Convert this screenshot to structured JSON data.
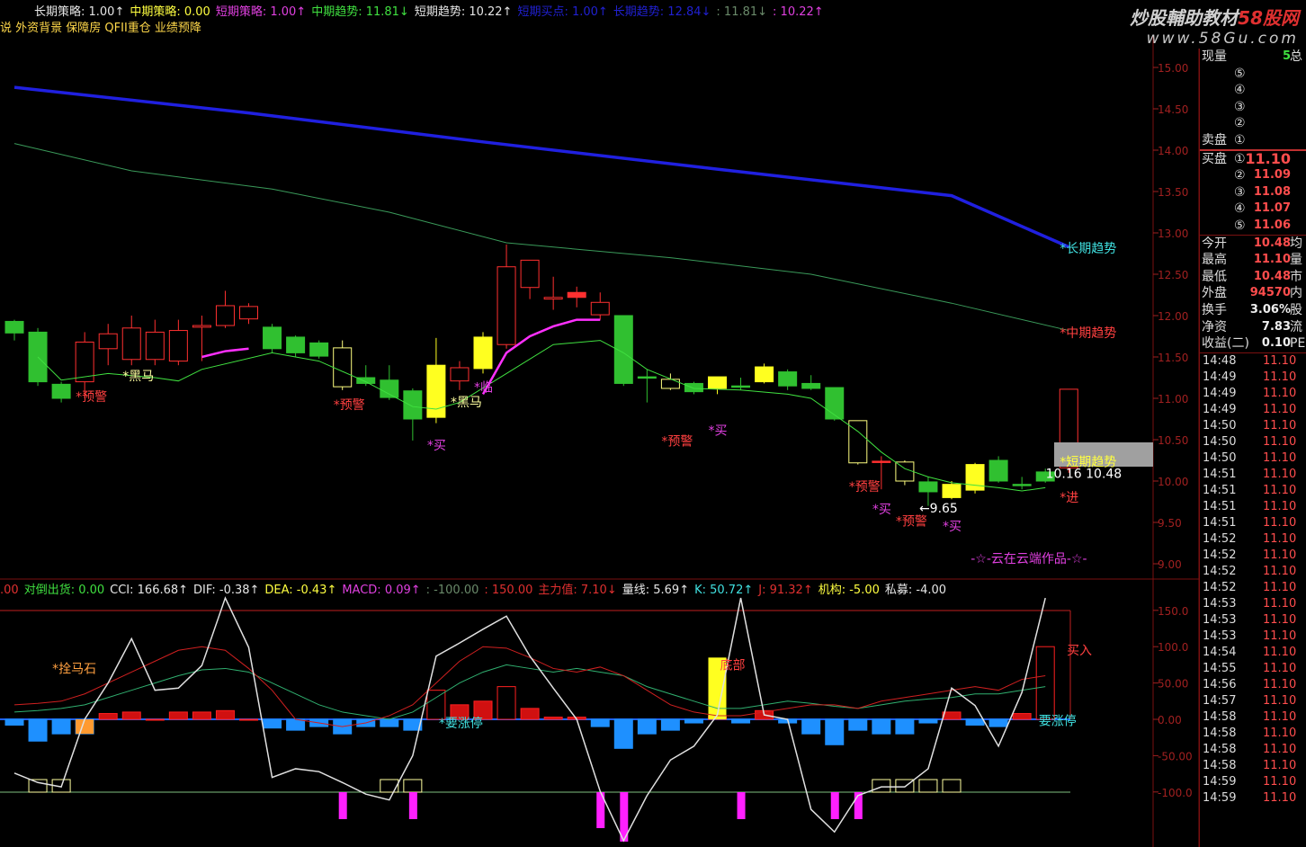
{
  "header": {
    "items": [
      {
        "label": "长期策略: 1.00↑",
        "color": "#e6e6e6"
      },
      {
        "label": "中期策略: 0.00",
        "color": "#ffff40"
      },
      {
        "label": "短期策略: 1.00↑",
        "color": "#e040e0"
      },
      {
        "label": "中期趋势: 11.81↓",
        "color": "#40e040"
      },
      {
        "label": "短期趋势: 10.22↑",
        "color": "#e6e6e6"
      },
      {
        "label": "短期买点: 1.00↑",
        "color": "#2020d0"
      },
      {
        "label": "长期趋势: 12.84↓",
        "color": "#2020d0"
      },
      {
        "label": ": 11.81↓",
        "color": "#6a8a6a"
      },
      {
        "label": ": 10.22↑",
        "color": "#e040e0"
      }
    ],
    "tags": "说 外资背景 保障房 QFII重仓 业绩预降"
  },
  "indicator_header": {
    "items": [
      {
        "label": ".00",
        "color": "#e03030"
      },
      {
        "label": "对倒出货: 0.00",
        "color": "#40e040"
      },
      {
        "label": "CCI: 166.68↑",
        "color": "#e6e6e6"
      },
      {
        "label": "DIF: -0.38↑",
        "color": "#e6e6e6"
      },
      {
        "label": "DEA: -0.43↑",
        "color": "#ffff40"
      },
      {
        "label": "MACD: 0.09↑",
        "color": "#e040e0"
      },
      {
        "label": ": -100.00",
        "color": "#6a8a6a"
      },
      {
        "label": ": 150.00",
        "color": "#e03030"
      },
      {
        "label": "主力值: 7.10↓",
        "color": "#e03030"
      },
      {
        "label": "量线: 5.69↑",
        "color": "#e6e6e6"
      },
      {
        "label": "K: 50.72↑",
        "color": "#40e0e0"
      },
      {
        "label": "J: 91.32↑",
        "color": "#e03030"
      },
      {
        "label": "机构: -5.00",
        "color": "#ffff40"
      },
      {
        "label": "私募: -4.00",
        "color": "#e6e6e6"
      }
    ]
  },
  "watermark": {
    "line1a": "炒股輔助教材",
    "line1b": "58股网",
    "line2": "www.58Gu.com"
  },
  "quote_panel": {
    "volume_label": "现量",
    "volume_value": "5",
    "total_label": "总",
    "sell_label": "卖盘",
    "buy_label": "买盘",
    "sell_levels": [
      "⑤",
      "④",
      "③",
      "②",
      "①"
    ],
    "buy_levels": [
      {
        "n": "①",
        "p": "11.10"
      },
      {
        "n": "②",
        "p": "11.09"
      },
      {
        "n": "③",
        "p": "11.08"
      },
      {
        "n": "④",
        "p": "11.07"
      },
      {
        "n": "⑤",
        "p": "11.06"
      }
    ],
    "stats": [
      {
        "l": "今开",
        "v": "10.48",
        "r": "均"
      },
      {
        "l": "最高",
        "v": "11.10",
        "r": "量"
      },
      {
        "l": "最低",
        "v": "10.48",
        "r": "市"
      },
      {
        "l": "外盘",
        "v": "94570",
        "r": "内"
      },
      {
        "l": "换手",
        "v": "3.06%",
        "r": "股"
      },
      {
        "l": "净资",
        "v": "7.83",
        "r": "流"
      },
      {
        "l": "收益(二)",
        "v": "0.10",
        "r": "PE"
      }
    ],
    "ticks": [
      {
        "t": "14:48",
        "p": "11.10"
      },
      {
        "t": "14:49",
        "p": "11.10"
      },
      {
        "t": "14:49",
        "p": "11.10"
      },
      {
        "t": "14:49",
        "p": "11.10"
      },
      {
        "t": "14:50",
        "p": "11.10"
      },
      {
        "t": "14:50",
        "p": "11.10"
      },
      {
        "t": "14:50",
        "p": "11.10"
      },
      {
        "t": "14:51",
        "p": "11.10"
      },
      {
        "t": "14:51",
        "p": "11.10"
      },
      {
        "t": "14:51",
        "p": "11.10"
      },
      {
        "t": "14:51",
        "p": "11.10"
      },
      {
        "t": "14:52",
        "p": "11.10"
      },
      {
        "t": "14:52",
        "p": "11.10"
      },
      {
        "t": "14:52",
        "p": "11.10"
      },
      {
        "t": "14:52",
        "p": "11.10"
      },
      {
        "t": "14:53",
        "p": "11.10"
      },
      {
        "t": "14:53",
        "p": "11.10"
      },
      {
        "t": "14:53",
        "p": "11.10"
      },
      {
        "t": "14:54",
        "p": "11.10"
      },
      {
        "t": "14:55",
        "p": "11.10"
      },
      {
        "t": "14:56",
        "p": "11.10"
      },
      {
        "t": "14:57",
        "p": "11.10"
      },
      {
        "t": "14:58",
        "p": "11.10"
      },
      {
        "t": "14:58",
        "p": "11.10"
      },
      {
        "t": "14:58",
        "p": "11.10"
      },
      {
        "t": "14:58",
        "p": "11.10"
      },
      {
        "t": "14:59",
        "p": "11.10"
      },
      {
        "t": "14:59",
        "p": "11.10"
      }
    ]
  },
  "chart_data": [
    {
      "type": "candlestick",
      "title": "price",
      "ylim": [
        9.0,
        15.0
      ],
      "yticks": [
        "15.00",
        "14.50",
        "14.00",
        "13.50",
        "13.00",
        "12.50",
        "12.00",
        "11.50",
        "11.00",
        "10.50",
        "10.00",
        "9.50",
        "9.00"
      ],
      "candles": [
        [
          11.93,
          11.79,
          11.95,
          11.7,
          "g"
        ],
        [
          11.8,
          11.2,
          11.85,
          11.15,
          "g"
        ],
        [
          11.17,
          11.0,
          11.2,
          10.95,
          "g"
        ],
        [
          11.2,
          11.68,
          11.8,
          11.0,
          "r"
        ],
        [
          11.6,
          11.78,
          11.9,
          11.4,
          "r"
        ],
        [
          11.47,
          11.85,
          12.0,
          11.4,
          "r"
        ],
        [
          11.47,
          11.8,
          11.95,
          11.4,
          "r"
        ],
        [
          11.45,
          11.82,
          11.95,
          11.4,
          "r"
        ],
        [
          11.86,
          11.88,
          12.0,
          11.45,
          "r"
        ],
        [
          11.88,
          12.12,
          12.3,
          11.85,
          "r"
        ],
        [
          11.96,
          12.11,
          12.15,
          11.9,
          "r"
        ],
        [
          11.86,
          11.6,
          11.9,
          11.55,
          "g"
        ],
        [
          11.74,
          11.55,
          11.76,
          11.5,
          "g"
        ],
        [
          11.67,
          11.51,
          11.7,
          11.48,
          "g"
        ],
        [
          11.14,
          11.61,
          11.7,
          11.1,
          "yh"
        ],
        [
          11.25,
          11.18,
          11.4,
          11.15,
          "g"
        ],
        [
          11.22,
          11.01,
          11.4,
          10.98,
          "g"
        ],
        [
          11.09,
          10.75,
          11.12,
          10.49,
          "g"
        ],
        [
          10.77,
          11.4,
          11.73,
          10.7,
          "y"
        ],
        [
          11.21,
          11.37,
          11.45,
          11.1,
          "r"
        ],
        [
          11.36,
          11.74,
          11.8,
          11.3,
          "y"
        ],
        [
          11.65,
          12.59,
          12.86,
          11.6,
          "r"
        ],
        [
          12.34,
          12.67,
          12.67,
          12.2,
          "r"
        ],
        [
          12.2,
          12.22,
          12.47,
          12.07,
          "r"
        ],
        [
          12.28,
          12.22,
          12.35,
          12.1,
          "r"
        ],
        [
          12.01,
          12.16,
          12.28,
          11.95,
          "r"
        ],
        [
          12.0,
          11.18,
          12.0,
          11.15,
          "g"
        ],
        [
          11.26,
          11.26,
          11.35,
          10.95,
          "g"
        ],
        [
          11.12,
          11.23,
          11.3,
          11.1,
          "yh"
        ],
        [
          11.18,
          11.08,
          11.2,
          11.05,
          "g"
        ],
        [
          11.12,
          11.26,
          11.26,
          11.05,
          "y"
        ],
        [
          11.15,
          11.15,
          11.25,
          11.1,
          "g"
        ],
        [
          11.2,
          11.38,
          11.42,
          11.18,
          "y"
        ],
        [
          11.32,
          11.15,
          11.35,
          11.1,
          "g"
        ],
        [
          11.18,
          11.12,
          11.28,
          11.1,
          "g"
        ],
        [
          11.13,
          10.75,
          11.13,
          10.73,
          "g"
        ],
        [
          10.22,
          10.73,
          10.73,
          10.2,
          "yh"
        ],
        [
          10.24,
          10.24,
          10.3,
          9.9,
          "r"
        ],
        [
          10.0,
          10.23,
          10.25,
          9.95,
          "yh"
        ],
        [
          9.99,
          9.87,
          10.05,
          9.7,
          "g"
        ],
        [
          9.8,
          9.96,
          10.0,
          9.78,
          "y"
        ],
        [
          9.89,
          10.2,
          10.22,
          9.85,
          "y"
        ],
        [
          10.25,
          10.0,
          10.3,
          9.98,
          "g"
        ],
        [
          9.96,
          9.95,
          10.05,
          9.9,
          "g"
        ],
        [
          10.11,
          10.0,
          10.15,
          9.98,
          "g"
        ],
        [
          10.16,
          11.11,
          11.11,
          10.1,
          "rh"
        ]
      ],
      "long_trend": [
        [
          0,
          14.76
        ],
        [
          10,
          14.45
        ],
        [
          20,
          14.1
        ],
        [
          30,
          13.77
        ],
        [
          40,
          13.45
        ],
        [
          45,
          12.83
        ]
      ],
      "mid_trend": [
        [
          0,
          14.08
        ],
        [
          5,
          13.75
        ],
        [
          11,
          13.53
        ],
        [
          16,
          13.25
        ],
        [
          21,
          12.88
        ],
        [
          28,
          12.7
        ],
        [
          34,
          12.5
        ],
        [
          40,
          12.15
        ],
        [
          45,
          11.82
        ]
      ],
      "short_trend": [
        [
          1,
          11.5
        ],
        [
          2,
          11.22
        ],
        [
          4,
          11.3
        ],
        [
          6,
          11.25
        ],
        [
          7,
          11.21
        ],
        [
          8,
          11.35
        ],
        [
          11,
          11.55
        ],
        [
          13,
          11.45
        ],
        [
          15,
          11.2
        ],
        [
          17,
          10.9
        ],
        [
          18,
          10.87
        ],
        [
          19,
          10.95
        ],
        [
          21,
          11.3
        ],
        [
          23,
          11.65
        ],
        [
          25,
          11.7
        ],
        [
          26,
          11.55
        ],
        [
          27,
          11.35
        ],
        [
          29,
          11.12
        ],
        [
          31,
          11.1
        ],
        [
          33,
          11.05
        ],
        [
          34,
          11.0
        ],
        [
          35,
          10.8
        ],
        [
          36,
          10.6
        ],
        [
          37,
          10.35
        ],
        [
          38,
          10.15
        ],
        [
          39,
          10.05
        ],
        [
          40,
          9.98
        ],
        [
          42,
          9.92
        ],
        [
          43,
          9.88
        ],
        [
          44,
          9.92
        ]
      ],
      "magenta_segments": [
        [
          [
            8,
            11.5
          ],
          [
            9,
            11.57
          ],
          [
            10,
            11.6
          ]
        ],
        [
          [
            20,
            11.05
          ],
          [
            21,
            11.55
          ],
          [
            22,
            11.75
          ],
          [
            23,
            11.87
          ],
          [
            24,
            11.95
          ],
          [
            25,
            11.95
          ]
        ]
      ],
      "annotations": [
        {
          "text": "*黑马",
          "i": 5,
          "p": 11.22,
          "c": "#ffffa0"
        },
        {
          "text": "*预警",
          "i": 3,
          "p": 10.97,
          "c": "#ff4040"
        },
        {
          "text": "*预警",
          "i": 14,
          "p": 10.87,
          "c": "#ff4040"
        },
        {
          "text": "*黑马",
          "i": 19,
          "p": 10.9,
          "c": "#ffffa0"
        },
        {
          "text": "*买",
          "i": 18,
          "p": 10.38,
          "c": "#e040e0"
        },
        {
          "text": "*临",
          "i": 20,
          "p": 11.08,
          "c": "#e040e0"
        },
        {
          "text": "*预警",
          "i": 28,
          "p": 10.43,
          "c": "#ff4040"
        },
        {
          "text": "*买",
          "i": 30,
          "p": 10.56,
          "c": "#e040e0"
        },
        {
          "text": "*预警",
          "i": 36,
          "p": 9.88,
          "c": "#ff4040"
        },
        {
          "text": "*买",
          "i": 37,
          "p": 9.61,
          "c": "#e040e0"
        },
        {
          "text": "*预警",
          "i": 38,
          "p": 9.46,
          "c": "#ff4040"
        },
        {
          "text": "*买",
          "i": 40,
          "p": 9.4,
          "c": "#e040e0"
        },
        {
          "text": "←9.65",
          "i": 39,
          "p": 9.62,
          "c": "#ffffff"
        },
        {
          "text": "*长期趋势",
          "i": 45,
          "p": 12.76,
          "c": "#40e0e0"
        },
        {
          "text": "*中期趋势",
          "i": 45,
          "p": 11.74,
          "c": "#ff4040"
        },
        {
          "text": "*短期趋势",
          "i": 45,
          "p": 10.18,
          "c": "#ffff40"
        },
        {
          "text": "10.16 10.48",
          "i": 44.4,
          "p": 10.04,
          "c": "#ffffff"
        },
        {
          "text": "*进",
          "i": 45,
          "p": 9.75,
          "c": "#ff4040"
        },
        {
          "text": "-☆-云在云端作品-☆-",
          "i": 41.2,
          "p": 9.01,
          "c": "#e040e0"
        }
      ]
    },
    {
      "type": "indicator",
      "ylim": [
        -170,
        170
      ],
      "yticks": [
        150,
        100,
        50,
        0,
        -50,
        -100
      ],
      "ytick_labels": [
        "150.0",
        "100.0",
        "50.00",
        "0.00",
        "-50.00",
        "-100.0"
      ],
      "white": [
        -74,
        -87,
        -93,
        0,
        50,
        111,
        40,
        43,
        74,
        167,
        99,
        -80,
        -68,
        -72,
        -87,
        -103,
        -111,
        -50,
        87,
        105,
        124,
        142,
        87,
        43,
        0,
        -99,
        -167,
        -105,
        -56,
        -37,
        6,
        167,
        6,
        0,
        -124,
        -155,
        -105,
        -93,
        -93,
        -68,
        43,
        19,
        -37,
        37,
        167
      ],
      "red": [
        20,
        22,
        25,
        35,
        50,
        65,
        80,
        95,
        100,
        95,
        70,
        40,
        0,
        -5,
        -10,
        -5,
        5,
        20,
        50,
        80,
        100,
        98,
        85,
        70,
        65,
        72,
        60,
        40,
        20,
        10,
        5,
        5,
        10,
        15,
        20,
        20,
        15,
        25,
        30,
        35,
        40,
        45,
        40,
        55,
        60
      ],
      "green": [
        10,
        12,
        15,
        20,
        30,
        40,
        50,
        60,
        68,
        70,
        65,
        50,
        35,
        20,
        10,
        5,
        0,
        10,
        30,
        50,
        65,
        75,
        70,
        65,
        70,
        65,
        60,
        45,
        35,
        25,
        15,
        15,
        20,
        25,
        22,
        18,
        15,
        20,
        25,
        28,
        30,
        35,
        35,
        40,
        45
      ],
      "bars": [
        -8,
        -30,
        -20,
        -20,
        8,
        10,
        0,
        10,
        10,
        12,
        0,
        -12,
        -15,
        -10,
        -20,
        -10,
        -10,
        -15,
        40,
        20,
        25,
        45,
        15,
        3,
        3,
        -10,
        -40,
        -20,
        -15,
        -5,
        5,
        -5,
        12,
        -5,
        -20,
        -35,
        -15,
        -20,
        -20,
        -5,
        10,
        -8,
        -10,
        8,
        100
      ],
      "yellow_bar": {
        "i": 30,
        "v": 85
      },
      "orange_bar": {
        "i": 3,
        "v": -20
      },
      "annotations": [
        {
          "text": "*拴马石",
          "i": 2,
          "v": 70,
          "c": "#ffa040"
        },
        {
          "text": "*要涨停",
          "i": 18.5,
          "v": -5,
          "c": "#40e0e0"
        },
        {
          "text": "底部",
          "i": 30.5,
          "v": 75,
          "c": "#ff4040"
        },
        {
          "text": "买入",
          "i": 45.3,
          "v": 95,
          "c": "#ff4040"
        },
        {
          "text": "要涨停",
          "i": 44.1,
          "v": -2,
          "c": "#40e0e0"
        }
      ]
    }
  ]
}
